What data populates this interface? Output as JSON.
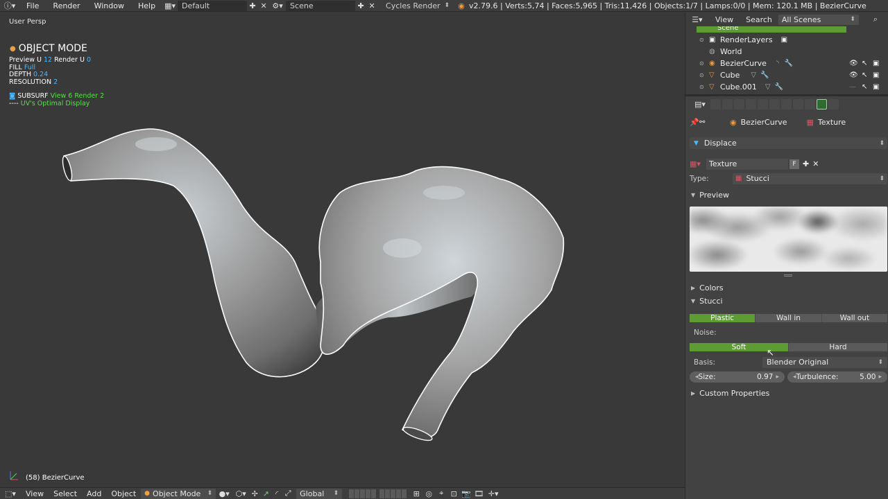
{
  "topbar": {
    "menus": [
      "File",
      "Render",
      "Window",
      "Help"
    ],
    "screen_layout": "Default",
    "scene": "Scene",
    "render_engine": "Cycles Render",
    "stats": "v2.79.6 | Verts:5,74 | Faces:5,965 | Tris:11,426 | Objects:1/7 | Lamps:0/0 | Mem: 120.1 MB | BezierCurve"
  },
  "viewport": {
    "view_label": "User Persp",
    "mode_title": "OBJECT MODE",
    "preview_label": "Preview U",
    "preview_value": "12",
    "render_label": "Render U",
    "render_value": "0",
    "fill_label": "FILL",
    "fill_value": "Full",
    "depth_label": "DEPTH",
    "depth_value": "0.24",
    "resolution_label": "RESOLUTION",
    "resolution_value": "2",
    "subsurf_label": "SUBSURF",
    "subsurf_view": "View 6",
    "subsurf_render": "Render 2",
    "uv_prefix": "----",
    "uv_text": "UV's  Optimal Display",
    "object_label": "(58) BezierCurve"
  },
  "bottombar": {
    "menus": [
      "View",
      "Select",
      "Add",
      "Object"
    ],
    "mode": "Object Mode",
    "orientation": "Global"
  },
  "outliner": {
    "menus": [
      "View",
      "Search"
    ],
    "filter": "All Scenes",
    "scene_row": "Scene",
    "items": [
      {
        "name": "RenderLayers"
      },
      {
        "name": "World"
      },
      {
        "name": "BezierCurve"
      },
      {
        "name": "Cube"
      },
      {
        "name": "Cube.001"
      }
    ]
  },
  "properties": {
    "breadcrumb_object": "BezierCurve",
    "breadcrumb_texture": "Texture",
    "displace_label": "Displace",
    "texture_name": "Texture",
    "fake_user": "F",
    "type_label": "Type:",
    "type_value": "Stucci",
    "preview_panel": "Preview",
    "colors_panel": "Colors",
    "stucci_panel": "Stucci",
    "stucci_types": [
      "Plastic",
      "Wall in",
      "Wall out"
    ],
    "stucci_active": 0,
    "noise_label": "Noise:",
    "noise_types": [
      "Soft",
      "Hard"
    ],
    "noise_active": 0,
    "basis_label": "Basis:",
    "basis_value": "Blender Original",
    "size_label": "Size:",
    "size_value": "0.97",
    "turbulence_label": "Turbulence:",
    "turbulence_value": "5.00",
    "custom_properties": "Custom Properties"
  },
  "colors": {
    "accent_green": "#5d9c33",
    "value_cyan": "#4bb8ff",
    "value_green": "#56e04a"
  }
}
